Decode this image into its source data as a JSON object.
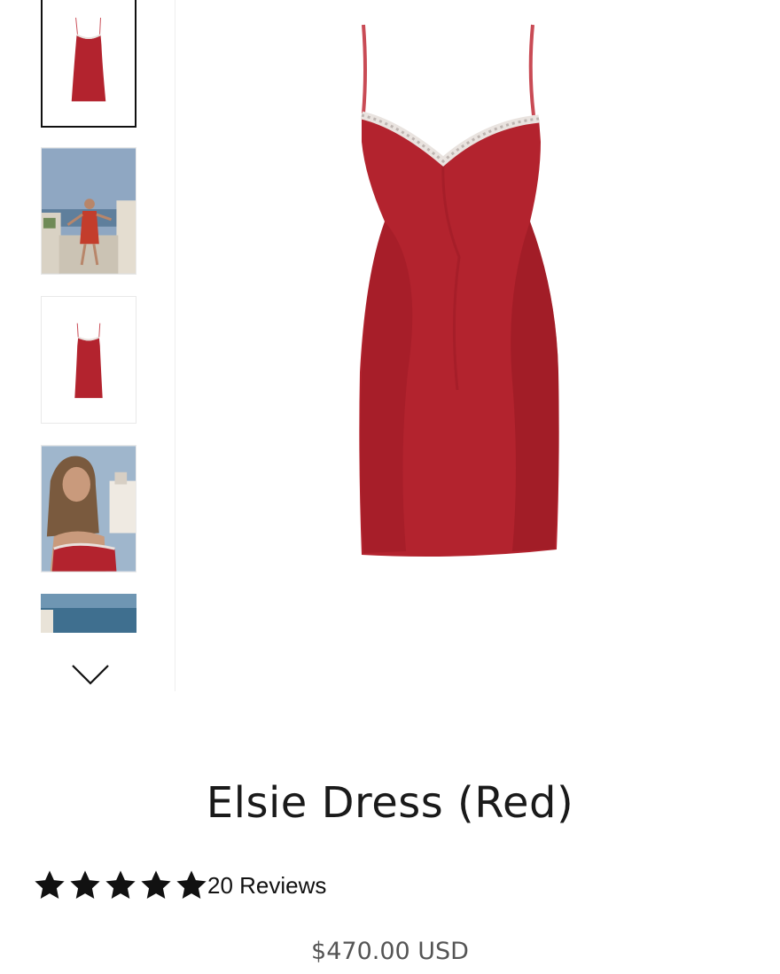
{
  "gallery": {
    "thumbnails": [
      {
        "name": "dress-front-red",
        "selected": true
      },
      {
        "name": "model-terrace-photo",
        "selected": false
      },
      {
        "name": "dress-front-red-small",
        "selected": false
      },
      {
        "name": "model-closeup-photo",
        "selected": false
      },
      {
        "name": "sea-view-photo",
        "selected": false
      }
    ],
    "scroll_down_icon": "chevron-down-icon",
    "main_image": "dress-front-red"
  },
  "product": {
    "title": "Elsie Dress (Red)",
    "rating": {
      "stars": 5,
      "max": 5,
      "reviews_label": "20 Reviews"
    },
    "price": "$470.00 USD"
  },
  "colors": {
    "dress": "#b3232e",
    "dress_shadow": "#8e1620",
    "text": "#1a1a1a",
    "price": "#555555"
  }
}
